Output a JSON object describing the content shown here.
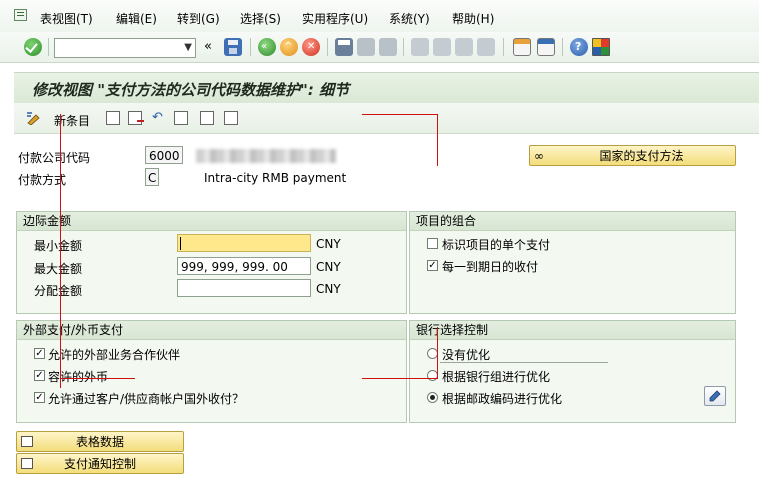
{
  "menu": {
    "items": [
      "表视图(T)",
      "编辑(E)",
      "转到(G)",
      "选择(S)",
      "实用程序(U)",
      "系统(Y)",
      "帮助(H)"
    ]
  },
  "toolbar": {
    "command_value": "",
    "icons": [
      "check-icon",
      "save-icon",
      "back-icon",
      "exit-icon",
      "cancel-icon",
      "print-icon",
      "find-icon",
      "find-next-icon",
      "first-page-icon",
      "prev-page-icon",
      "next-page-icon",
      "last-page-icon",
      "new-session-icon",
      "shortcut-icon",
      "help-icon",
      "customize-icon"
    ]
  },
  "title": "修改视图 \"支付方法的公司代码数据维护\": 细节",
  "app_toolbar": {
    "new_entries": "新条目"
  },
  "header": {
    "company_code_label": "付款公司代码",
    "company_code_value": "6000",
    "payment_method_label": "付款方式",
    "payment_method_value": "C",
    "payment_method_text": "Intra-city RMB payment",
    "country_button": "国家的支付方法"
  },
  "amount_group": {
    "title": "边际金额",
    "min_label": "最小金额",
    "min_value": "",
    "max_label": "最大金额",
    "max_value": "999, 999, 999. 00",
    "dist_label": "分配金额",
    "dist_value": "",
    "currency": "CNY"
  },
  "items_group": {
    "title": "项目的组合",
    "opt1": "标识项目的单个支付",
    "opt1_checked": false,
    "opt2": "每一到期日的收付",
    "opt2_checked": true
  },
  "foreign_group": {
    "title": "外部支付/外币支付",
    "opt1": "允许的外部业务合作伙伴",
    "opt1_checked": true,
    "opt2": "容许的外币",
    "opt2_checked": true,
    "opt3": "允许通过客户/供应商帐户国外收付？",
    "opt3_checked": true
  },
  "bank_group": {
    "title": "银行选择控制",
    "opt1": "没有优化",
    "opt2": "根据银行组进行优化",
    "opt3": "根据邮政编码进行优化",
    "selected": 3
  },
  "bottom_buttons": {
    "table_data": "表格数据",
    "notice_control": "支付通知控制"
  },
  "colors": {
    "annotation_red": "#d01010",
    "button_yellow": "#f3dd7b",
    "required_field": "#ffe88c"
  }
}
